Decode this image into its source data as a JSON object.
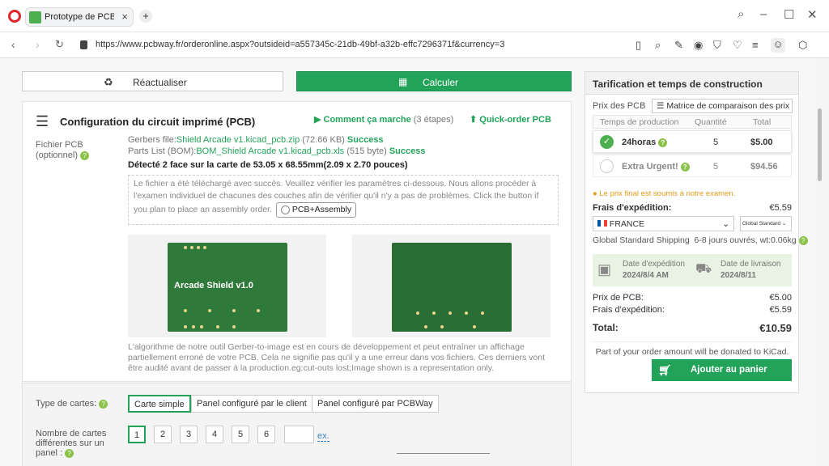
{
  "browser": {
    "tab_title": "Prototype de PCB – Devis",
    "url": "https://www.pcbway.fr/orderonline.aspx?outsideid=a557345c-21db-49bf-a32b-effc7296371f&currency=3"
  },
  "toolbar": {
    "refresh": "Réactualiser",
    "calc": "Calculer"
  },
  "config": {
    "title": "Configuration du circuit imprimé (PCB)",
    "how": "Comment ça marche",
    "how_steps": "(3 étapes)",
    "quick": "Quick-order PCB",
    "file_label": "Fichier PCB (optionnel)",
    "gerber_label": "Gerbers file:",
    "gerber_file": "Shield Arcade v1.kicad_pcb.zip",
    "gerber_size": "(72.66 KB)",
    "gerber_status": "Success",
    "bom_label": "Parts List (BOM):",
    "bom_file": "BOM_Shield Arcade v1.kicad_pcb.xls",
    "bom_size": "(515 byte)",
    "bom_status": "Success",
    "detected": "Détecté 2 face sur la carte de 53.05 x 68.55mm(2.09 x 2.70 pouces)",
    "notice": "Le fichier a été téléchargé avec succès. Veuillez vérifier les paramètres ci-dessous. Nous allons procéder à l'examen individuel de chacunes des couches afin de vérifier qu'il n'y a pas de problèmes. Click the button if you plan to place an assembly order.",
    "assembly": "PCB+Assembly",
    "pcb_label": "Arcade Shield v1.0",
    "disclaimer": "L'algorithme de notre outil Gerber-to-image est en cours de développement et peut entraîner un affichage partiellement erroné de votre PCB. Cela ne signifie pas qu'il y a une erreur dans vos fichiers. Ces derniers vont être audité avant de passer à la production.eg:cut-outs lost;Image shown is a representation only."
  },
  "options": {
    "type_label": "Type de cartes:",
    "types": [
      "Carte simple",
      "Panel configuré par le client",
      "Panel configuré par PCBWay"
    ],
    "count_label": "Nombre de cartes différentes sur un panel :",
    "counts": [
      "1",
      "2",
      "3",
      "4",
      "5",
      "6"
    ],
    "ex": "ex."
  },
  "pricing": {
    "title": "Tarification et temps de construction",
    "price_label": "Prix des PCB",
    "matrix": "Matrice de comparaison des prix",
    "col_time": "Temps de production",
    "col_qty": "Quantité",
    "col_total": "Total",
    "rows": [
      {
        "name": "24horas",
        "qty": "5",
        "total": "$5.00"
      },
      {
        "name": "Extra Urgent!",
        "qty": "5",
        "total": "$94.56"
      }
    ],
    "review": "Le prix final est soumis à notre examen.",
    "ship_label": "Frais d'expédition:",
    "ship_value": "€5.59",
    "country": "FRANCE",
    "method": "Global Standard",
    "ship_info": "Global Standard Shipping",
    "ship_days": "6-8 jours ouvrés, wt:0.06kg",
    "exp_label": "Date d'expédition",
    "exp_date": "2024/8/4 AM",
    "del_label": "Date de livraison",
    "del_date": "2024/8/11",
    "pcb_price_label": "Prix de PCB:",
    "pcb_price": "€5.00",
    "ship2_label": "Frais d'expédition:",
    "ship2": "€5.59",
    "total_label": "Total:",
    "total": "€10.59",
    "donate": "Part of your order amount will be donated to KiCad.",
    "cart": "Ajouter au panier"
  }
}
